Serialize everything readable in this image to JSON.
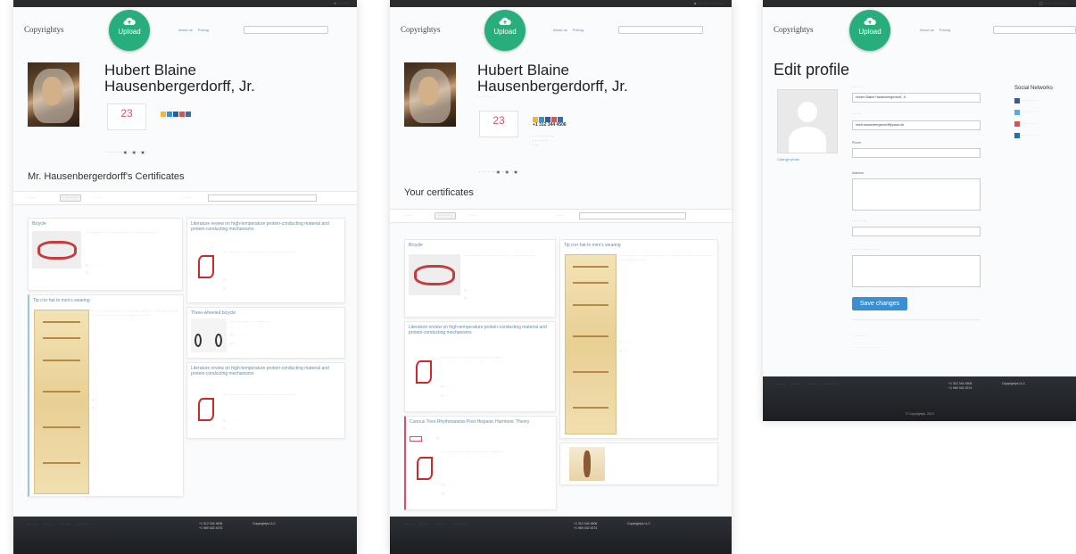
{
  "brand": {
    "logo": "Copyrightys",
    "upload_label": "Upload"
  },
  "nav": {
    "about": "About us",
    "pricing": "Pricing"
  },
  "profile": {
    "name_line1": "Hubert Blaine",
    "name_line2": "Hausenbergerdorff, Jr.",
    "count": "23",
    "phone": "+1 312 344 4506"
  },
  "screen1": {
    "section_title": "Mr. Hausenbergerdorff's Certificates"
  },
  "screen2": {
    "section_title": "Your certificates"
  },
  "cards": {
    "bicycle": "Bicycle",
    "tips": "Tip o'er hat to men's wearing",
    "lit_review": "Literature review on high-temperature protein-conducting material and protein-conducting mechanisms",
    "three_wheel": "Three-wheeled bicycle",
    "curious": "Curious Tires Rhythmanesis Post-Hispanic Harmonic Theory"
  },
  "edit": {
    "title": "Edit profile",
    "change_photo": "Change photo",
    "name_value": "Hubert Blaine Hausenbergerdorff, Jr.",
    "email_value": "hbert.hausenbergerdorff@yaolo.de",
    "phone_label": "Phone",
    "address_label": "Address",
    "save": "Save changes",
    "social_title": "Social Networks"
  },
  "footer": {
    "phones": "+1 312 344 4506\n+1 969 402 4374",
    "company": "Copyrightys LLC",
    "copyright": "© Copyrightys, 2013"
  },
  "colors": {
    "accent": "#27ae7c",
    "link": "#5a8fc0",
    "highlight": "#d94f6a",
    "footer": "#1c1e22",
    "save_button": "#3a8fd3"
  }
}
